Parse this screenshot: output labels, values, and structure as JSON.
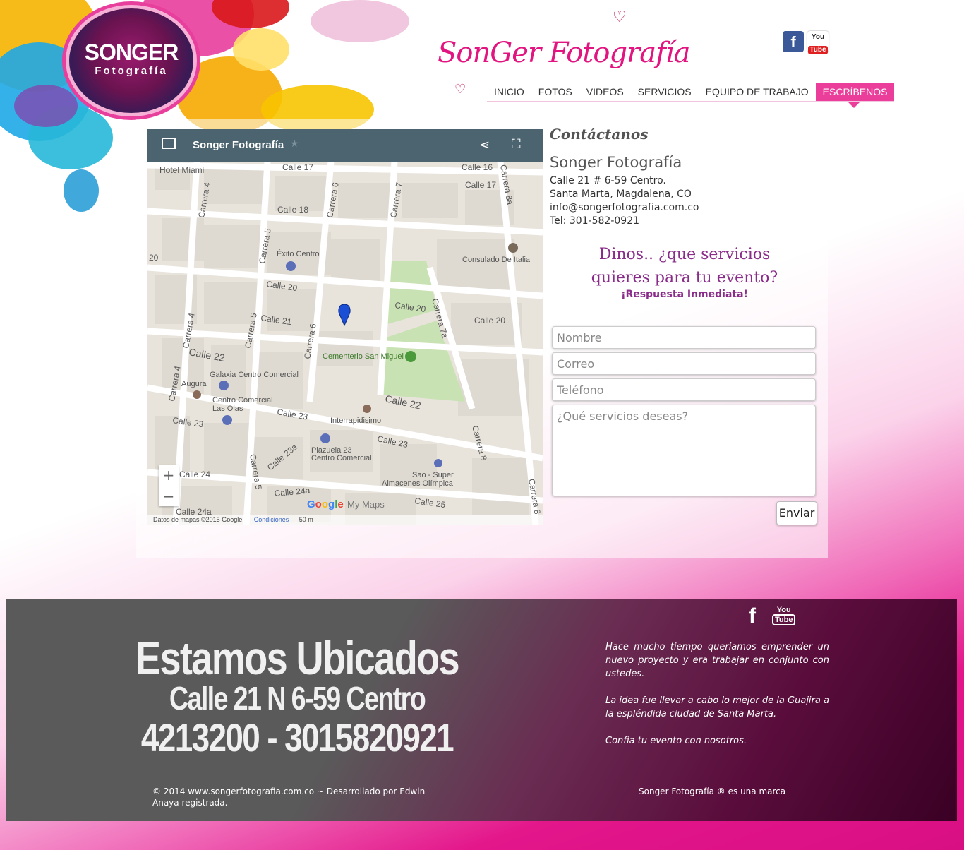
{
  "brand": {
    "logo_main": "SONGER",
    "logo_sub": "Fotografía",
    "script_title": "SonGer Fotografía"
  },
  "social": {
    "facebook_icon": "f",
    "youtube_you": "You",
    "youtube_tube": "Tube"
  },
  "nav": {
    "items": [
      "INICIO",
      "FOTOS",
      "VIDEOS",
      "SERVICIOS",
      "EQUIPO DE TRABAJO",
      "ESCRÍBENOS"
    ],
    "active": "ESCRÍBENOS",
    "accent_color": "#ea3e9a"
  },
  "map": {
    "title": "Songer Fotografía",
    "labels": {
      "hotel": "Hotel Miami",
      "calle17a": "Calle 17",
      "calle16": "Calle 16",
      "calle17b": "Calle 17",
      "calle18": "Calle 18",
      "carrera4a": "Carrera 4",
      "carrera6a": "Carrera 6",
      "carrera7": "Carrera 7",
      "carrera8a": "Carrera 8a",
      "exito": "Éxito Centro",
      "consulado": "Consulado De Italia",
      "carrera5a": "Carrera 5",
      "calle20a": "Calle 20",
      "calle20b": "Calle 20",
      "calle20c": "Calle 20",
      "carrera7a": "Carrera 7a",
      "carrera4b": "Carrera 4",
      "carrera5b": "Carrera 5",
      "calle21": "Calle 21",
      "carrera6b": "Carrera 6",
      "calle22a": "Calle 22",
      "cementerio": "Cementerio San Miguel",
      "galaxia": "Galaxia Centro Comercial",
      "augura": "Augura",
      "carrera4c": "Carrera 4",
      "ccolas1": "Centro Comercial",
      "ccolas2": "Las Olas",
      "calle23a": "Calle 23",
      "calle23b": "Calle 23",
      "calle22b": "Calle 22",
      "interrapidisimo": "Interrapidisimo",
      "calle23c": "Calle 23",
      "carrera8b": "Carrera 8",
      "plazuela1": "Plazuela 23",
      "plazuela2": "Centro Comercial",
      "calle23a2": "Calle 23a",
      "carrera5c": "Carrera 5",
      "sao1": "Sao - Super",
      "sao2": "Almacenes Olímpica",
      "calle24": "Calle 24",
      "calle24a": "Calle 24a",
      "calle25": "Calle 25",
      "carrera8c": "Carrera 8",
      "num20": "20",
      "calle24a2": "Calle 24a"
    },
    "zoom_in": "+",
    "zoom_out": "−",
    "google_letters": [
      "G",
      "o",
      "o",
      "g",
      "l",
      "e"
    ],
    "google_colors": [
      "#4285f4",
      "#ea4335",
      "#fbbc05",
      "#4285f4",
      "#34a853",
      "#ea4335"
    ],
    "my_maps": "My Maps",
    "attribution": "Datos de mapas ©2015 Google",
    "terms": "Condiciones",
    "scale": "50 m"
  },
  "contact": {
    "heading": "Contáctanos",
    "name": "Songer Fotografía",
    "address": "Calle 21 # 6-59 Centro.",
    "city": "Santa Marta, Magdalena, CO",
    "email": "info@songerfotografia.com.co",
    "phone": "Tel: 301-582-0921",
    "pitch_line1": "Dinos.. ¿que servicios",
    "pitch_line2": "quieres para tu evento?",
    "pitch_sub": "¡Respuesta Inmediata!"
  },
  "form": {
    "name_placeholder": "Nombre",
    "email_placeholder": "Correo",
    "phone_placeholder": "Teléfono",
    "message_placeholder": "¿Qué servicios deseas?",
    "submit_label": "Enviar"
  },
  "footer": {
    "headline": "Estamos Ubicados",
    "address": "Calle 21 N 6-59 Centro",
    "phones": "4213200 - 3015820921",
    "text1": "Hace mucho tiempo queriamos emprender un nuevo proyecto y era trabajar en conjunto con ustedes.",
    "text2": "La idea fue llevar a cabo lo mejor de la Guajira  a la espléndida ciudad de Santa Marta.",
    "text3": "Confia tu evento con nosotros.",
    "copyright": "© 2014 www.songerfotografia.com.co ~ Desarrollado por Edwin Anaya registrada.",
    "trademark": "Songer Fotografía ® es una marca",
    "facebook_icon": "f",
    "youtube_you": "You",
    "youtube_tube": "Tube"
  }
}
